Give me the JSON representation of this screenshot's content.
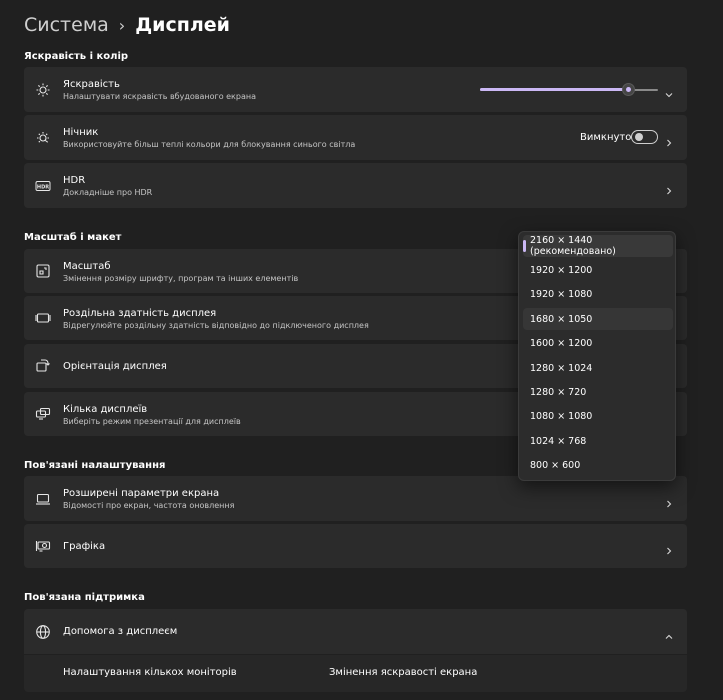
{
  "breadcrumb": {
    "parent": "Система",
    "separator": "›",
    "current": "Дисплей"
  },
  "sections": {
    "brightness_color": "Яскравість і колір",
    "scale_layout": "Масштаб і макет",
    "related_settings": "Пов'язані налаштування",
    "related_support": "Пов'язана підтримка"
  },
  "brightness": {
    "title": "Яскравість",
    "subtitle": "Налаштувати яскравість вбудованого екрана",
    "level_percent": 83
  },
  "night_light": {
    "title": "Нічник",
    "subtitle": "Використовуйте більш теплі кольори для блокування синього світла",
    "state_label": "Вимкнуто"
  },
  "hdr": {
    "title": "HDR",
    "subtitle": "Докладніше про HDR"
  },
  "scale": {
    "title": "Масштаб",
    "subtitle": "Змінення розміру шрифту, програм та інших елементів"
  },
  "resolution": {
    "title": "Роздільна здатність дисплея",
    "subtitle": "Відрегулюйте роздільну здатність відповідно до  підключеного дисплея",
    "options": [
      "2160 × 1440 (рекомендовано)",
      "1920 × 1200",
      "1920 × 1080",
      "1680 × 1050",
      "1600 × 1200",
      "1280 × 1024",
      "1280 × 720",
      "1080 × 1080",
      "1024 × 768",
      "800 × 600"
    ],
    "selected_index": 0,
    "hover_index": 3
  },
  "orientation": {
    "title": "Орієнтація дисплея"
  },
  "multiple_displays": {
    "title": "Кілька дисплеїв",
    "subtitle": "Виберіть режим презентації для дисплеїв"
  },
  "advanced_display": {
    "title": "Розширені параметри екрана",
    "subtitle": "Відомості про екран, частота оновлення"
  },
  "graphics": {
    "title": "Графіка"
  },
  "help_display": {
    "title": "Допомога з дисплеєм",
    "links": [
      "Налаштування кількох моніторів",
      "Змінення яскравості екрана"
    ]
  },
  "colors": {
    "accent": "#cbb8f5",
    "background": "#202020",
    "card": "#2b2b2b"
  }
}
